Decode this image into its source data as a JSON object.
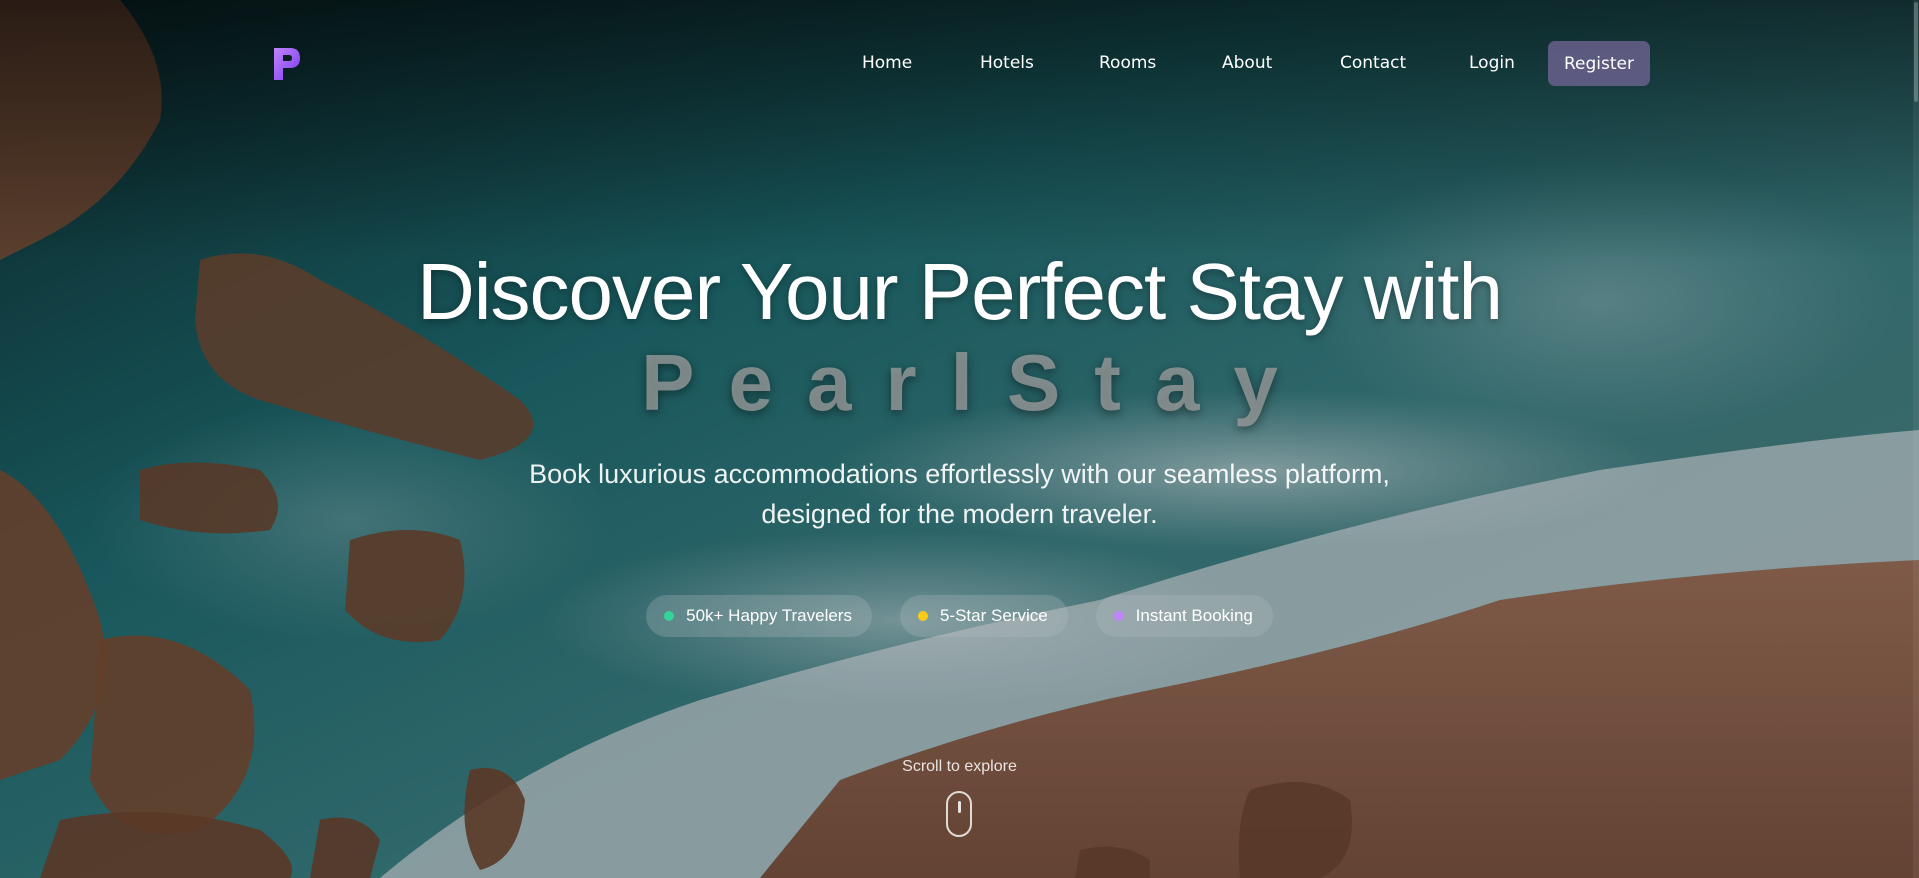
{
  "nav": {
    "logo_icon": "purple-p-logo",
    "links": [
      {
        "label": "Home"
      },
      {
        "label": "Hotels"
      },
      {
        "label": "Rooms"
      },
      {
        "label": "About"
      },
      {
        "label": "Contact"
      },
      {
        "label": "Login"
      }
    ],
    "register_label": "Register"
  },
  "hero": {
    "title": "Discover Your Perfect Stay with",
    "brand": "PearlStay",
    "subtitle_line1": "Book luxurious accommodations effortlessly with our seamless platform,",
    "subtitle_line2": "designed for the modern traveler.",
    "badges": [
      {
        "label": "50k+ Happy Travelers",
        "color": "#34d399"
      },
      {
        "label": "5-Star Service",
        "color": "#facc15"
      },
      {
        "label": "Instant Booking",
        "color": "#c084fc"
      }
    ],
    "scroll_label": "Scroll to explore",
    "scroll_icon": "mouse-scroll-icon"
  },
  "colors": {
    "accent": "#a855f7",
    "register_bg": "#68608c"
  }
}
